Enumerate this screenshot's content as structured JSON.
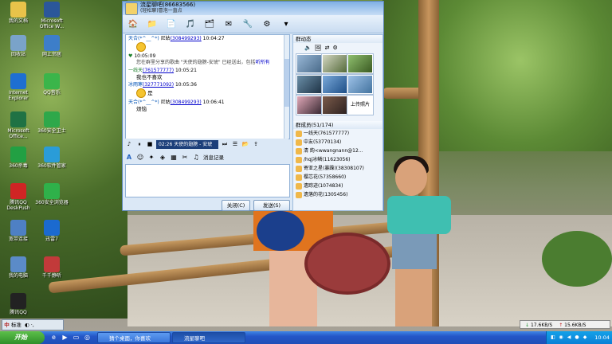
{
  "desktop_icons": [
    {
      "label": "我的文档",
      "icon": "folder-icon",
      "color": "#e8c34a"
    },
    {
      "label": "Microsoft Office W...",
      "icon": "word-icon",
      "color": "#2b579a"
    },
    {
      "label": "回收站",
      "icon": "recycle-bin-icon",
      "color": "#7aa3c9"
    },
    {
      "label": "网上邻居",
      "icon": "network-icon",
      "color": "#3d7ec9"
    },
    {
      "label": "Internet Explorer",
      "icon": "ie-icon",
      "color": "#1e6fd1"
    },
    {
      "label": "QQ音乐",
      "icon": "qq-music-icon",
      "color": "#3bb54a"
    },
    {
      "label": "Microsoft Office...",
      "icon": "excel-icon",
      "color": "#1f7244"
    },
    {
      "label": "360安全卫士",
      "icon": "360-icon",
      "color": "#2ea84a"
    },
    {
      "label": "360杀毒",
      "icon": "360-antivirus-icon",
      "color": "#22a043"
    },
    {
      "label": "360软件管家",
      "icon": "360-software-icon",
      "color": "#2a9cd8"
    },
    {
      "label": "腾讯QQ DeskPush",
      "icon": "qq-icon",
      "color": "#d02424"
    },
    {
      "label": "360安全浏览器",
      "icon": "360-browser-icon",
      "color": "#2fb14a"
    },
    {
      "label": "宽带连接",
      "icon": "broadband-icon",
      "color": "#4e80c4"
    },
    {
      "label": "迅雷7",
      "icon": "xunlei-icon",
      "color": "#1b6ad0"
    },
    {
      "label": "我的电脑",
      "icon": "computer-icon",
      "color": "#5b8bc8"
    },
    {
      "label": "千千静听",
      "icon": "ttplayer-icon",
      "color": "#c23a3a"
    },
    {
      "label": "腾讯QQ",
      "icon": "tencent-qq-icon",
      "color": "#222222"
    }
  ],
  "chat_window": {
    "title_name": "流星聊吧(86683566)",
    "title_sig": "(轻松聊)冒泡一直点",
    "toolbar_icons": [
      "home-icon",
      "folder-icon",
      "doc-icon",
      "music-icon",
      "app-icon",
      "mail-icon",
      "tools-icon",
      "settings-icon",
      "more-icon"
    ],
    "messages": [
      {
        "name": "天合(*^__^*)",
        "nick": "尼姑",
        "qq": "(308499293)",
        "time": "10:04:27",
        "body_type": "emoji"
      },
      {
        "type": "note",
        "time": "10:05:09",
        "text": "您在群里分享的歌曲 \"天使的翅膀-安琥\" 已经送出，包括",
        "link": "听所有"
      },
      {
        "name": "一线天",
        "qq": "(761577777)",
        "time": "10:05:21",
        "body": "我也不喜欢",
        "color": "green"
      },
      {
        "name": "冰雨寒",
        "qq": "(327771092)",
        "time": "10:05:36",
        "body": "是",
        "color": "blue"
      },
      {
        "name": "天合(*^__^*)",
        "nick": "尼姑",
        "qq": "(308499293)",
        "time": "10:06:41",
        "body": "烦恼",
        "emoji": true
      }
    ],
    "music": {
      "time": "02:26",
      "song": "天使的翅膀 - 安琥"
    },
    "history_label": "消息记录",
    "close_label": "关闭(C)",
    "send_label": "发送(S)"
  },
  "group_panel": {
    "header": "群动态",
    "upload_label": "上传照片",
    "members_header": "群成员(51/174)",
    "members": [
      "一线天(761577777)",
      "中友(53770134)",
      "清  韵<wwangnann@12...",
      "/hqj冰鳞(11623056)",
      "寄亚之星(暴躁)(38308107)",
      "樱芯花(57358660)",
      "遗踪迹(1074834)",
      "遗落的花(1305456)"
    ]
  },
  "ime": {
    "label": "标准"
  },
  "net_speed": {
    "down": "17.6KB/S",
    "up": "15.6KB/S"
  },
  "taskbar": {
    "start_label": "开始",
    "tasks": [
      {
        "label": "猜个桌面，你喜欢",
        "active": false
      },
      {
        "label": "流星聊吧",
        "active": true
      }
    ],
    "clock": "10:04"
  }
}
